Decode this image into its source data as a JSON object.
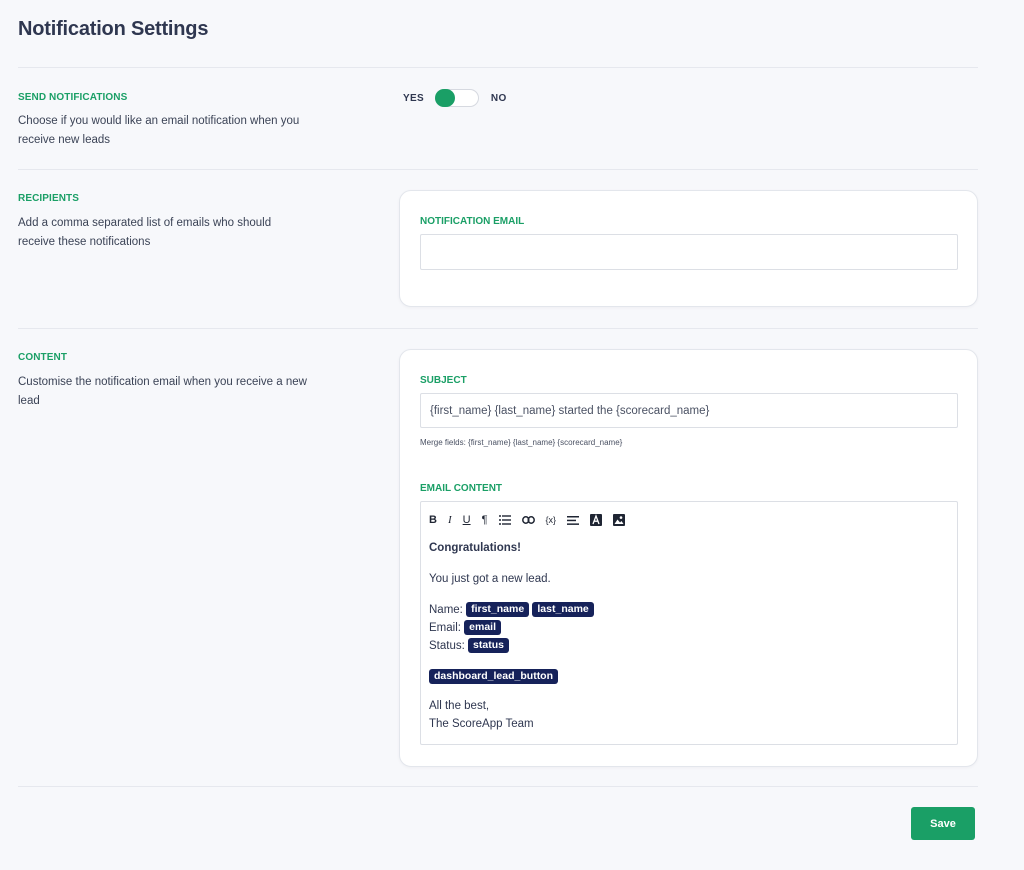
{
  "page": {
    "title": "Notification Settings"
  },
  "send_notifications": {
    "label": "SEND NOTIFICATIONS",
    "description": "Choose if you would like an email notification when you receive new leads",
    "yes_label": "YES",
    "no_label": "NO",
    "enabled": true
  },
  "recipients": {
    "label": "RECIPIENTS",
    "description": "Add a comma separated list of emails who should receive these notifications",
    "email_field_label": "NOTIFICATION EMAIL",
    "email_value": ""
  },
  "content": {
    "label": "CONTENT",
    "description": "Customise the notification email when you receive a new lead",
    "subject_label": "SUBJECT",
    "subject_value": "{first_name} {last_name} started the {scorecard_name}",
    "merge_hint": "Merge fields: {first_name} {last_name} {scorecard_name}",
    "email_content_label": "EMAIL CONTENT",
    "toolbar": {
      "bold": "B",
      "italic": "I",
      "underline": "U",
      "paragraph": "¶",
      "list": "☰",
      "link": "⊖",
      "variable": "{x}",
      "align": "☰"
    },
    "body": {
      "greeting": "Congratulations!",
      "intro": "You just got a new lead.",
      "name_label": "Name:",
      "name_tag_1": "first_name",
      "name_tag_2": "last_name",
      "email_label": "Email:",
      "email_tag": "email",
      "status_label": "Status:",
      "status_tag": "status",
      "button_tag": "dashboard_lead_button",
      "signoff_1": "All the best,",
      "signoff_2": "The ScoreApp Team"
    }
  },
  "actions": {
    "save_label": "Save"
  },
  "colors": {
    "accent": "#1a9f66",
    "tag": "#16225a",
    "title": "#2f3750"
  }
}
